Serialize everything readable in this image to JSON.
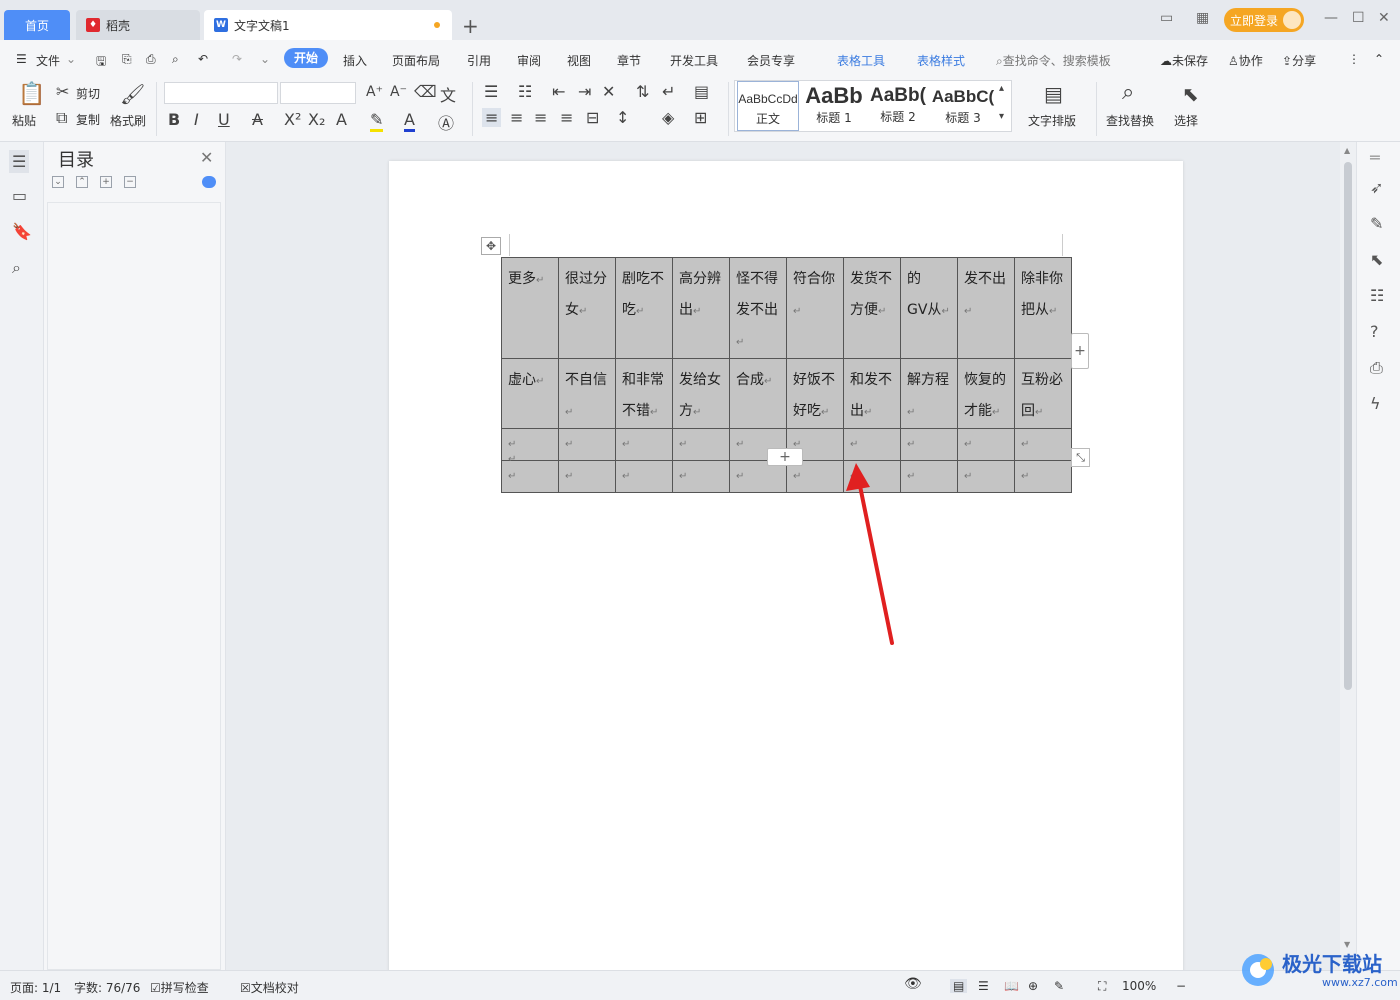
{
  "tabs": {
    "home": "首页",
    "daoke": "稻壳",
    "doc": "文字文稿1",
    "login": "立即登录"
  },
  "menu": {
    "file": "文件",
    "items": [
      "开始",
      "插入",
      "页面布局",
      "引用",
      "审阅",
      "视图",
      "章节",
      "开发工具",
      "会员专享"
    ],
    "table_tools": "表格工具",
    "table_style": "表格样式",
    "search_placeholder": "查找命令、搜索模板",
    "unsaved": "未保存",
    "collab": "协作",
    "share": "分享"
  },
  "ribbon": {
    "paste": "粘贴",
    "cut": "剪切",
    "copy": "复制",
    "format_painter": "格式刷",
    "styles": [
      {
        "sample": "AaBbCcDd",
        "name": "正文"
      },
      {
        "sample": "AaBb",
        "name": "标题 1"
      },
      {
        "sample": "AaBb(",
        "name": "标题 2"
      },
      {
        "sample": "AaBbC(",
        "name": "标题 3"
      }
    ],
    "text_layout": "文字排版",
    "find_replace": "查找替换",
    "select": "选择"
  },
  "toc": {
    "title": "目录"
  },
  "table": {
    "rows": [
      [
        "更多",
        "很过分女",
        "剧吃不吃",
        "高分辨出",
        "怪不得发不出",
        "符合你",
        "发货不方便",
        "的　GV从",
        "发不出",
        "除非你把从"
      ],
      [
        "虚心",
        "不自信",
        "和非常不错",
        "发给女方",
        "合成",
        "好饭不好吃",
        "和发不出",
        "解方程",
        "恢复的才能",
        "互粉必回"
      ],
      [
        "",
        "",
        "",
        "",
        "",
        "",
        "",
        "",
        "",
        ""
      ],
      [
        "",
        "",
        "",
        "",
        "",
        "",
        "",
        "",
        "",
        ""
      ]
    ]
  },
  "status": {
    "page": "页面: 1/1",
    "words": "字数: 76/76",
    "spell": "拼写检查",
    "proof": "文档校对",
    "zoom": "100%"
  },
  "watermark": {
    "title": "极光下载站",
    "url": "www.xz7.com"
  },
  "colors": {
    "accent": "#4f8ef7",
    "login": "#f5a623",
    "table_fill": "#c4c4c4",
    "arrow": "#e02020"
  }
}
